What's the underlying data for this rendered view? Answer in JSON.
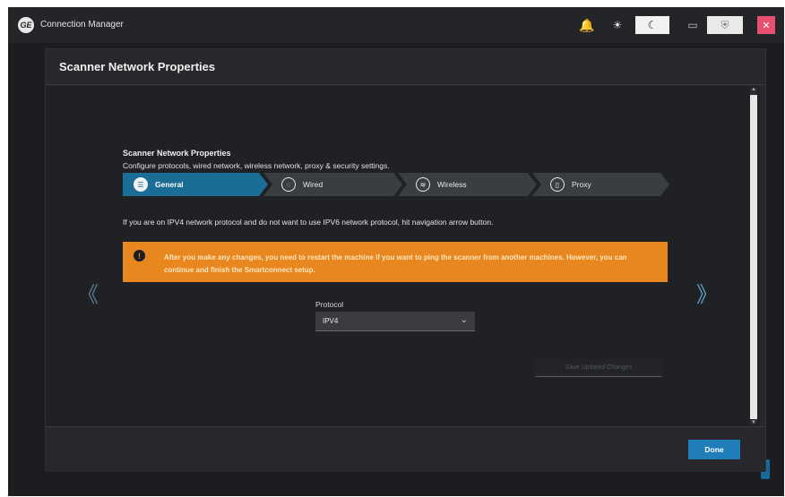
{
  "window": {
    "app_title": "Connection Manager",
    "logo_text": "GE"
  },
  "topbar": {
    "bell_icon": "🔔",
    "sun_icon": "☀",
    "moon_icon": "☾",
    "monitor_icon": "▭",
    "shield_icon": "⛨",
    "close_icon": "✕"
  },
  "modal": {
    "title": "Scanner Network Properties",
    "section_title": "Scanner Network Properties",
    "section_desc": "Configure protocols, wired network, wireless network, proxy & security settings.",
    "steps": [
      {
        "label": "General",
        "icon": "☰",
        "active": true
      },
      {
        "label": "Wired",
        "icon": "◌",
        "active": false
      },
      {
        "label": "Wireless",
        "icon": "≋",
        "active": false
      },
      {
        "label": "Proxy",
        "icon": "▯",
        "active": false
      }
    ],
    "info_text": "If you are on IPV4 network protocol and do not want to use IPV6 network protocol, hit navigation arrow button.",
    "warning": {
      "icon": "!",
      "text": "After you make any changes, you need to restart the machine if you want to ping the scanner from another machines. However, you can continue and finish the Smartconnect setup."
    },
    "nav_prev": "《",
    "nav_next": "》",
    "protocol": {
      "label": "Protocol",
      "value": "IPV4",
      "chevron": "⌄"
    },
    "save_label": "Save Updated Changes",
    "done_label": "Done",
    "scroll_up": "▲",
    "scroll_down": "▼"
  },
  "colors": {
    "accent": "#1a6e96",
    "warning": "#e8861f",
    "done_button": "#1f7eb8",
    "close_button": "#e84e6e"
  }
}
